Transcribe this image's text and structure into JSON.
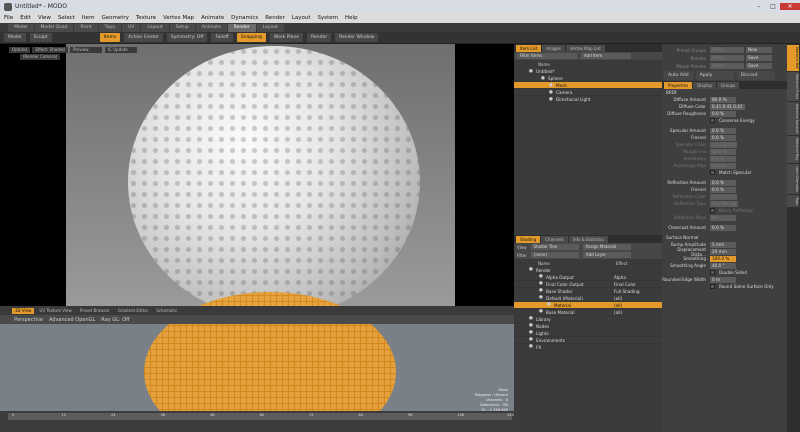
{
  "window": {
    "title": "Untitled* - MODO",
    "min": "–",
    "max": "□",
    "close": "✕"
  },
  "menu": [
    "File",
    "Edit",
    "View",
    "Select",
    "Item",
    "Geometry",
    "Texture",
    "Vertex Map",
    "Animate",
    "Dynamics",
    "Render",
    "Layout",
    "System",
    "Help"
  ],
  "layout_tabs": [
    {
      "label": "Model",
      "on": false
    },
    {
      "label": "Model Quad",
      "on": false
    },
    {
      "label": "Paint",
      "on": false
    },
    {
      "label": "Topo",
      "on": false
    },
    {
      "label": "UV",
      "on": false
    },
    {
      "label": "Layout",
      "on": false
    },
    {
      "label": "Setup",
      "on": false
    },
    {
      "label": "Animate",
      "on": false
    },
    {
      "label": "Render",
      "on": true
    },
    {
      "label": "Layout",
      "on": false
    }
  ],
  "toolbar": {
    "model": "Model",
    "sculpt": "Sculpt",
    "items": "Items",
    "action_center": "Action Center",
    "symmetry": "Symmetry: Off",
    "falloff": "Falloff",
    "snapping": "Snapping",
    "work_plane": "Work Plane",
    "render": "Render",
    "render_window": "Render Window"
  },
  "viewport": {
    "options": "Options",
    "effect": "Effect: Shaded",
    "camera": "(Render Camera)",
    "btn1": "Preview",
    "btn2": "IC Update"
  },
  "bottom_viewport": {
    "tabs": [
      "3D View",
      "UV Texture View",
      "Preset Browser",
      "Gradient Editor",
      "Schematic"
    ],
    "bar": [
      "Perspective",
      "Advanced OpenGL",
      "Ray GL: Off"
    ],
    "stats": [
      "Mesh",
      "Polygons : Unicorn",
      "Channels : 0",
      "Deformers : ON",
      "GL : 1,746,560",
      "0 mm"
    ]
  },
  "timeline": {
    "ticks": [
      "0",
      "12",
      "24",
      "36",
      "48",
      "60",
      "72",
      "84",
      "96",
      "108",
      "120"
    ]
  },
  "item_list": {
    "tabs": [
      "Item List",
      "Images",
      "Vertex Map List"
    ],
    "filter": "Filter Items",
    "add": "Add Item",
    "col": "Name",
    "items": [
      {
        "label": "Untitled*",
        "sel": false
      },
      {
        "label": "Sphere",
        "sel": false
      },
      {
        "label": "Mesh",
        "sel": true
      },
      {
        "label": "Camera",
        "sel": false
      },
      {
        "label": "Directional Light",
        "sel": false
      }
    ]
  },
  "shading": {
    "tabs": [
      "Shading",
      "Channels",
      "Info & Statistics"
    ],
    "view": "Shader Tree",
    "assign": "Assign Material",
    "filter": "(none)",
    "add": "Add Layer",
    "cols": [
      "Name",
      "Effect"
    ],
    "rows": [
      {
        "name": "Render",
        "effect": "",
        "sel": false
      },
      {
        "name": "Alpha Output",
        "effect": "Alpha",
        "sel": false
      },
      {
        "name": "Final Color Output",
        "effect": "Final Color",
        "sel": false
      },
      {
        "name": "Base Shader",
        "effect": "Full Shading",
        "sel": false
      },
      {
        "name": "Default (Material)",
        "effect": "(all)",
        "sel": false
      },
      {
        "name": "Material",
        "effect": "(all)",
        "sel": true
      },
      {
        "name": "Base Material",
        "effect": "(all)",
        "sel": false
      },
      {
        "name": "Library",
        "effect": "",
        "sel": false
      },
      {
        "name": "Nodes",
        "effect": "",
        "sel": false
      },
      {
        "name": "Lights",
        "effect": "",
        "sel": false
      },
      {
        "name": "Environments",
        "effect": "",
        "sel": false
      },
      {
        "name": "FX",
        "effect": "",
        "sel": false
      }
    ]
  },
  "presets": {
    "rows": [
      {
        "label": "Preset Groups",
        "a": "Select",
        "b": "New"
      },
      {
        "label": "Presets",
        "a": "Select",
        "b": "Save"
      },
      {
        "label": "Morph Presets",
        "a": "Select",
        "b": "Save"
      }
    ]
  },
  "properties": {
    "auto_add": "Auto Add",
    "apply": "Apply",
    "discard": "Discard",
    "tabs": [
      "Properties",
      "Display",
      "Groups"
    ],
    "section": "BRDF",
    "fields": [
      {
        "label": "Diffuse Amount",
        "value": "80.0 %"
      },
      {
        "label": "Diffuse Color",
        "value": "0.41   0.41   0.41"
      },
      {
        "label": "Diffuse Roughness",
        "value": "0.0 %"
      },
      {
        "label": "Conserve Energy",
        "value": "check"
      },
      {
        "label": "Specular Amount",
        "value": "0.0 %"
      },
      {
        "label": "Fresnel",
        "value": "0.0 %"
      },
      {
        "label": "Specular Color",
        "value": "1.0   1.0   1.0",
        "dim": true
      },
      {
        "label": "Roughness",
        "value": "40.0 %",
        "dim": true
      },
      {
        "label": "Anisotropy",
        "value": "0.0 %",
        "dim": true
      },
      {
        "label": "Anisotropy Map",
        "value": "(none)",
        "dim": true
      },
      {
        "label": "Match Specular",
        "value": "check"
      },
      {
        "label": "Reflection Amount",
        "value": "0.0 %"
      },
      {
        "label": "Fresnel",
        "value": "0.0 %"
      },
      {
        "label": "Reflection Color",
        "value": "1.0   1.0   1.0",
        "dim": true
      },
      {
        "label": "Reflection Type",
        "value": "Ray Tracing",
        "dim": true
      },
      {
        "label": "Blurry Reflection",
        "value": "check",
        "dim": true
      },
      {
        "label": "Reflection Rays",
        "value": "64",
        "dim": true
      },
      {
        "label": "Clearcoat Amount",
        "value": "0.0 %"
      },
      {
        "label": "Surface Normal",
        "value": "section"
      },
      {
        "label": "Bump Amplitude",
        "value": "5 mm"
      },
      {
        "label": "Displacement Dista...",
        "value": "20 mm"
      },
      {
        "label": "Smoothing",
        "value": "100.0 %",
        "bar": true
      },
      {
        "label": "Smoothing Angle",
        "value": "40.0 °"
      },
      {
        "label": "Double Sided",
        "value": "check"
      },
      {
        "label": "Rounded Edge Width",
        "value": "0 m"
      },
      {
        "label": "Round Same Surface Only",
        "value": "check"
      }
    ],
    "vtabs": [
      "Material Ref",
      "Material Trans",
      "Material Subsurf",
      "Material Ray",
      "User Channels",
      "Tags"
    ]
  }
}
